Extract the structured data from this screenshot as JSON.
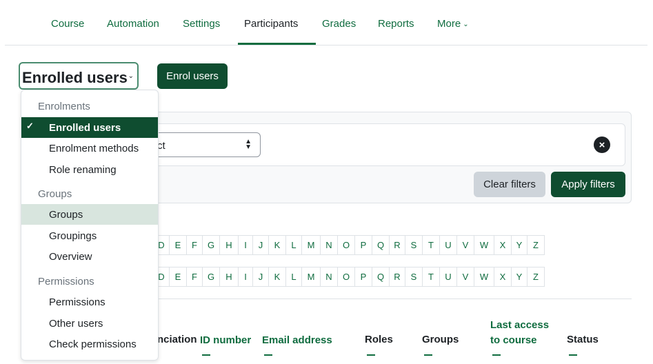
{
  "nav": {
    "items": [
      {
        "label": "Course"
      },
      {
        "label": "Automation"
      },
      {
        "label": "Settings"
      },
      {
        "label": "Participants"
      },
      {
        "label": "Grades"
      },
      {
        "label": "Reports"
      },
      {
        "label": "More"
      }
    ],
    "active": "Participants",
    "more_icon": "chevron-down-icon"
  },
  "page_select": {
    "value": "Enrolled users"
  },
  "enrol_button": "Enrol users",
  "filters": {
    "select_value": "ct",
    "remove_icon": "close-circle-icon",
    "clear_label": "Clear filters",
    "apply_label": "Apply filters"
  },
  "letters_row1": [
    "D",
    "E",
    "F",
    "G",
    "H",
    "I",
    "J",
    "K",
    "L",
    "M",
    "N",
    "O",
    "P",
    "Q",
    "R",
    "S",
    "T",
    "U",
    "V",
    "W",
    "X",
    "Y",
    "Z"
  ],
  "letters_row2": [
    "D",
    "E",
    "F",
    "G",
    "H",
    "I",
    "J",
    "K",
    "L",
    "M",
    "N",
    "O",
    "P",
    "Q",
    "R",
    "S",
    "T",
    "U",
    "V",
    "W",
    "X",
    "Y",
    "Z"
  ],
  "table_headers": {
    "name_partial": "nciation",
    "id_number": "ID number",
    "email": "Email address",
    "roles": "Roles",
    "groups": "Groups",
    "last_access_line1": "Last access",
    "last_access_line2": "to course",
    "status": "Status"
  },
  "dropdown": {
    "enrolments_header": "Enrolments",
    "enrolled_users": "Enrolled users",
    "enrolment_methods": "Enrolment methods",
    "role_renaming": "Role renaming",
    "groups_header": "Groups",
    "groups": "Groups",
    "groupings": "Groupings",
    "overview": "Overview",
    "permissions_header": "Permissions",
    "permissions": "Permissions",
    "other_users": "Other users",
    "check_permissions": "Check permissions",
    "check_icon": "checkmark-icon"
  },
  "colors": {
    "brand": "#0f4d30",
    "link": "#0f6c3f",
    "hover": "#d8e5de",
    "secondary_button": "#ced4da"
  }
}
